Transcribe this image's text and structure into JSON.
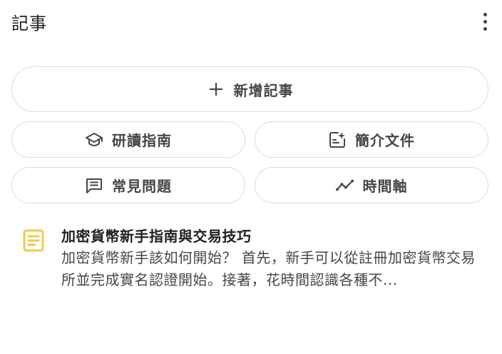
{
  "header": {
    "title": "記事",
    "more_icon": "more-vert-icon"
  },
  "actions": {
    "add_note": {
      "label": "新增記事",
      "icon": "plus-icon"
    },
    "study_guide": {
      "label": "研讀指南",
      "icon": "graduation-cap-icon"
    },
    "briefing_doc": {
      "label": "簡介文件",
      "icon": "doc-sparkle-icon"
    },
    "faq": {
      "label": "常見問題",
      "icon": "chat-lines-icon"
    },
    "timeline": {
      "label": "時間軸",
      "icon": "trend-line-icon"
    }
  },
  "notes": [
    {
      "title": "加密貨幣新手指南與交易技巧",
      "snippet": "加密貨幣新手該如何開始？ 首先，新手可以從註冊加密貨幣交易所並完成實名認證開始。接著，花時間認識各種不...",
      "icon": "note-icon",
      "icon_color": "#f2c94c"
    }
  ],
  "colors": {
    "border": "#dadce0",
    "label": "#444746",
    "note_icon": "#f2c94c"
  }
}
